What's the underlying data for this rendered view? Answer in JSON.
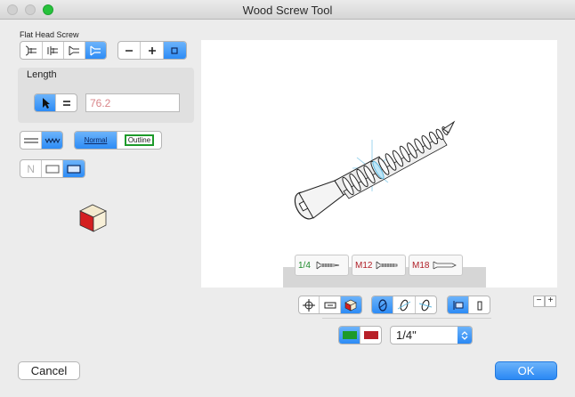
{
  "window": {
    "title": "Wood Screw Tool"
  },
  "head_type": {
    "label": "Flat Head Screw",
    "selected_index": 3
  },
  "length": {
    "label": "Length",
    "value": "76.2"
  },
  "style": {
    "normal_label": "Normal",
    "outline_label": "Outline"
  },
  "text_mode": {
    "none_label": "N"
  },
  "presets": [
    {
      "label": "1/4",
      "color": "#1d8a2a"
    },
    {
      "label": "M12",
      "color": "#b02028"
    },
    {
      "label": "M18",
      "color": "#b02028"
    }
  ],
  "zoom": {
    "minus_label": "−",
    "plus_label": "+"
  },
  "size_select": {
    "value": "1/4\""
  },
  "buttons": {
    "cancel": "Cancel",
    "ok": "OK"
  },
  "colors": {
    "accent": "#2d8cf6",
    "green": "#1d9a2a",
    "red": "#b82028",
    "cube_red": "#d42020",
    "cube_cream": "#f6ecd0"
  }
}
